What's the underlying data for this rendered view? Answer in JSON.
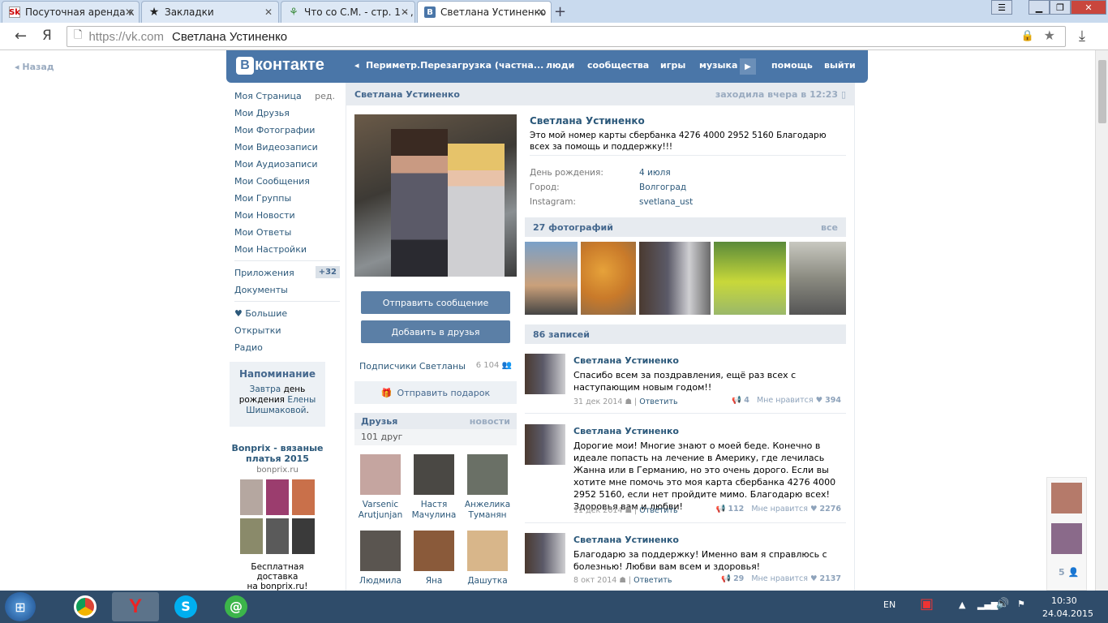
{
  "browser": {
    "tabs": [
      {
        "label": "Посуточная аренда к",
        "icon": "sk-favicon"
      },
      {
        "label": "Закладки",
        "icon": "star-icon"
      },
      {
        "label": "Что со С.М. - стр. 1 - ,",
        "icon": "forum-favicon"
      },
      {
        "label": "Светлана Устиненко",
        "icon": "vk-favicon"
      }
    ],
    "url_prefix": "https://vk.com",
    "url_title": "Светлана Устиненко",
    "yandex": "Я"
  },
  "vk": {
    "logo": "контакте",
    "logo_letter": "В",
    "nav_now_playing": "Периметр.Перезагрузка (частна...",
    "nav": [
      "люди",
      "сообщества",
      "игры",
      "музыка",
      "помощь",
      "выйти"
    ],
    "back": "Назад"
  },
  "left_menu": {
    "items": [
      "Моя Страница",
      "Мои Друзья",
      "Мои Фотографии",
      "Мои Видеозаписи",
      "Мои Аудиозаписи",
      "Мои Сообщения",
      "Мои Группы",
      "Мои Новости",
      "Мои Ответы",
      "Мои Настройки"
    ],
    "edit": "ред.",
    "apps": "Приложения",
    "apps_badge": "+32",
    "docs": "Документы",
    "extras": [
      "♥ Большие",
      "Открытки",
      "Радио"
    ],
    "reminder": {
      "title": "Напоминание",
      "line1": "Завтра",
      "line1b": "день",
      "line2": "рождения",
      "name1": "Елены",
      "name2": "Шишмаковой",
      "dot": "."
    },
    "ad": {
      "title": "Bonprix - вязаные платья 2015",
      "domain": "bonprix.ru",
      "text1": "Бесплатная доставка",
      "text2": "на bonprix.ru!"
    }
  },
  "profile": {
    "header_name": "Светлана Устиненко",
    "last_seen": "заходила вчера в 12:23",
    "name": "Светлана Устиненко",
    "status": "Это мой номер карты сбербанка 4276 4000 2952 5160 Благодарю всех за помощь и поддержку!!!",
    "info": [
      {
        "label": "День рождения:",
        "value": "4 июля"
      },
      {
        "label": "Город:",
        "value": "Волгоград"
      },
      {
        "label": "Instagram:",
        "value": "svetlana_ust"
      }
    ],
    "send_message": "Отправить сообщение",
    "add_friend": "Добавить в друзья",
    "followers_label": "Подписчики Светланы",
    "followers_count": "6 104",
    "send_gift": "Отправить подарок",
    "friends_title": "Друзья",
    "friends_news": "новости",
    "friends_count": "101 друг",
    "friends": [
      {
        "first": "Varsenic",
        "last": "Arutjunjan"
      },
      {
        "first": "Настя",
        "last": "Мачулина"
      },
      {
        "first": "Анжелика",
        "last": "Туманян"
      },
      {
        "first": "Людмила",
        "last": ""
      },
      {
        "first": "Яна",
        "last": ""
      },
      {
        "first": "Дашутка",
        "last": ""
      }
    ],
    "photos_title": "27 фотографий",
    "photos_all": "все",
    "wall_title": "86 записей"
  },
  "posts": [
    {
      "author": "Светлана Устиненко",
      "text": "Спасибо всем за поздравления, ещё раз всех с наступающим новым годом!!",
      "date": "31 дек 2014",
      "reply": "Ответить",
      "reposts": "4",
      "likes_label": "Мне нравится",
      "likes": "394"
    },
    {
      "author": "Светлана Устиненко",
      "text": "Дорогие мои! Многие знают о моей беде. Конечно в идеале попасть на лечение в Америку, где лечилась Жанна или в Германию, но это очень дорого. Если вы хотите мне помочь это моя карта сбербанка 4276 4000 2952 5160, если нет пройдите мимо. Благодарю всех! Здоровья вам и любви!",
      "date": "11 дек 2014",
      "reply": "Ответить",
      "reposts": "112",
      "likes_label": "Мне нравится",
      "likes": "2276"
    },
    {
      "author": "Светлана Устиненко",
      "text": "Благодарю за поддержку! Именно вам я справлюсь с болезнью! Любви вам всем и здоровья!",
      "date": "8 окт 2014",
      "reply": "Ответить",
      "reposts": "29",
      "likes_label": "Мне нравится",
      "likes": "2137"
    }
  ],
  "chat_sidebar": {
    "online_count": "5"
  },
  "taskbar": {
    "lang": "EN",
    "time": "10:30",
    "date": "24.04.2015"
  }
}
